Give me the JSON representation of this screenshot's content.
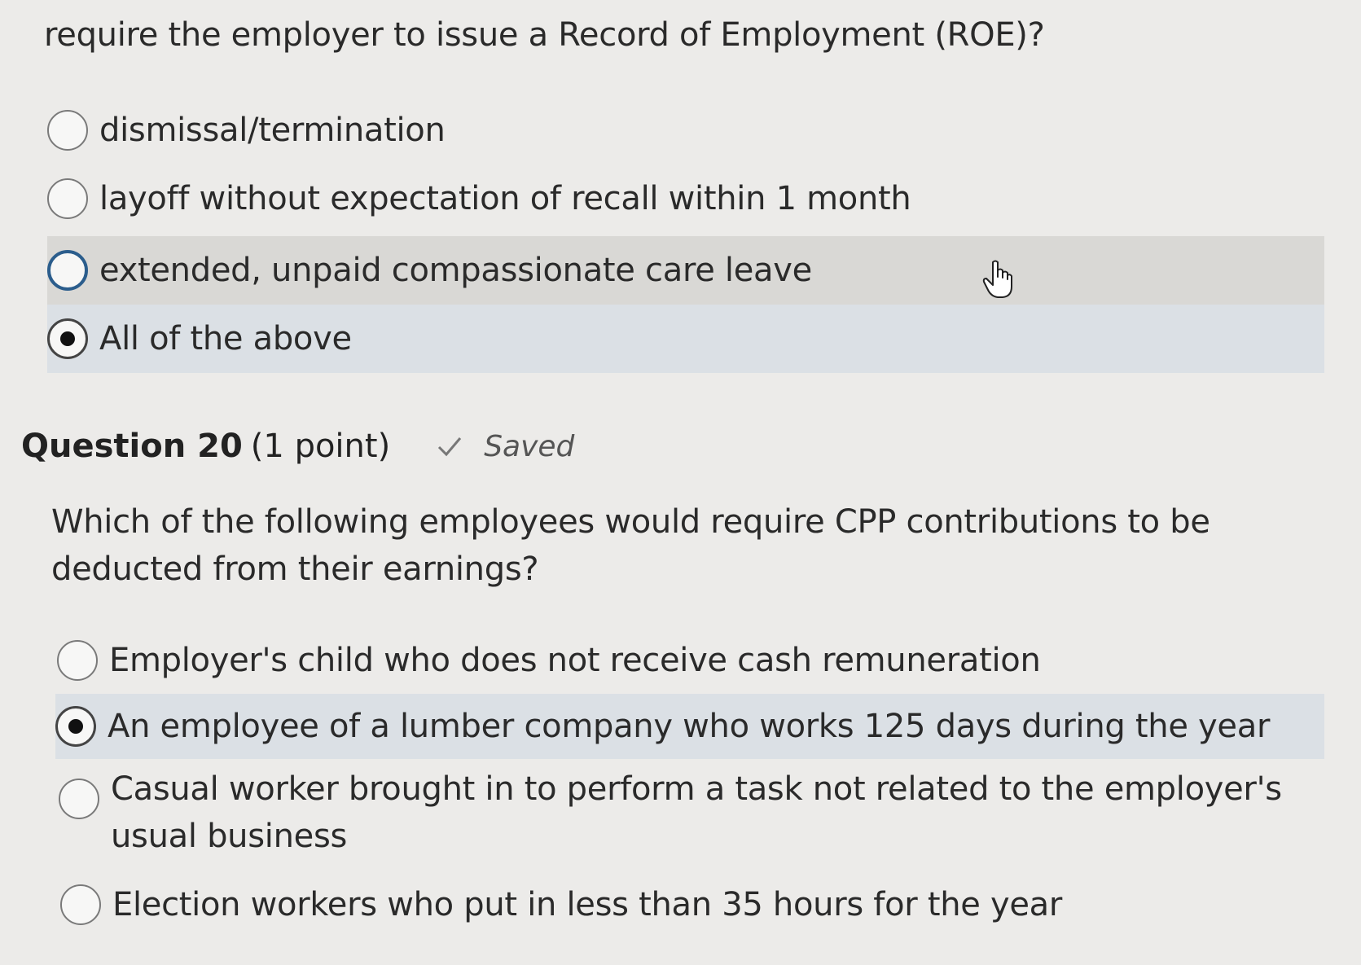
{
  "q19": {
    "stem_tail": "require the employer to issue a Record of Employment (ROE)?",
    "options": [
      {
        "label": "dismissal/termination",
        "selected": false
      },
      {
        "label": "layoff without expectation of recall within 1 month",
        "selected": false
      },
      {
        "label": "extended, unpaid compassionate care leave",
        "selected": false
      },
      {
        "label": "All of the above",
        "selected": true
      }
    ]
  },
  "q20": {
    "number": "Question 20",
    "points": "(1 point)",
    "status": "Saved",
    "text": "Which of the following employees would require CPP contributions to be deducted from their earnings?",
    "options": [
      {
        "label": "Employer's child who does not receive cash remuneration",
        "selected": false
      },
      {
        "label": "An employee of a lumber company who works 125 days during the year",
        "selected": true
      },
      {
        "label": "Casual worker brought in to perform a task not related to the employer's usual business",
        "selected": false
      },
      {
        "label": "Election workers who put in less than 35 hours for the year",
        "selected": false
      }
    ]
  },
  "icons": {
    "saved_check": "checkmark-icon",
    "cursor": "hand-pointer-cursor-icon"
  }
}
